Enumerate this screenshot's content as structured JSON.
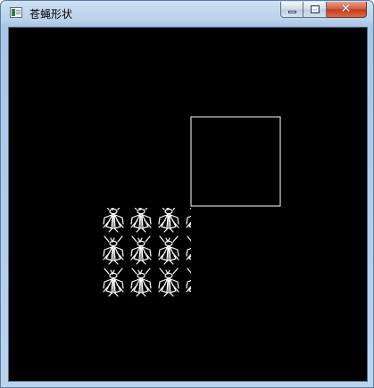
{
  "window": {
    "title": "苍蝇形状",
    "close_glyph": "✕"
  },
  "canvas": {
    "background": "#000000",
    "stroke_color": "#ffffff",
    "fly_pattern": {
      "rows": 3,
      "columns_visible": 3.3
    }
  }
}
